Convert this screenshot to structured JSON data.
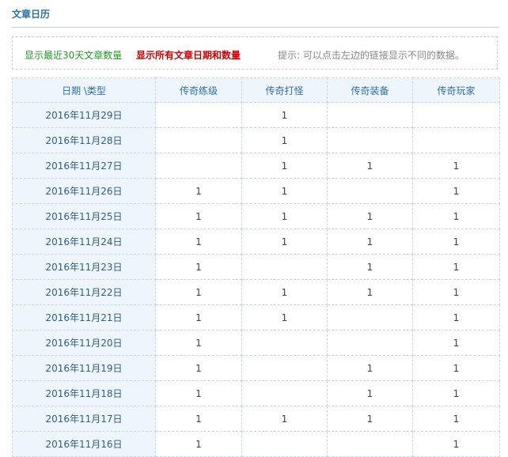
{
  "page": {
    "title": "文章日历"
  },
  "filter": {
    "recent_link": "显示最近30天文章数量",
    "all_link": "显示所有文章日期和数量",
    "hint": "提示: 可以点击左边的链接显示不同的数据。"
  },
  "table": {
    "headers": [
      "日期 \\类型",
      "传奇练级",
      "传奇打怪",
      "传奇装备",
      "传奇玩家"
    ],
    "rows": [
      {
        "date": "2016年11月29日",
        "counts": [
          "",
          "1",
          "",
          ""
        ]
      },
      {
        "date": "2016年11月28日",
        "counts": [
          "",
          "1",
          "",
          ""
        ]
      },
      {
        "date": "2016年11月27日",
        "counts": [
          "",
          "1",
          "1",
          "1"
        ]
      },
      {
        "date": "2016年11月26日",
        "counts": [
          "1",
          "1",
          "",
          "1"
        ]
      },
      {
        "date": "2016年11月25日",
        "counts": [
          "1",
          "1",
          "1",
          "1"
        ]
      },
      {
        "date": "2016年11月24日",
        "counts": [
          "1",
          "1",
          "1",
          "1"
        ]
      },
      {
        "date": "2016年11月23日",
        "counts": [
          "1",
          "",
          "1",
          "1"
        ]
      },
      {
        "date": "2016年11月22日",
        "counts": [
          "1",
          "1",
          "1",
          "1"
        ]
      },
      {
        "date": "2016年11月21日",
        "counts": [
          "1",
          "1",
          "",
          "1"
        ]
      },
      {
        "date": "2016年11月20日",
        "counts": [
          "1",
          "",
          "",
          "1"
        ]
      },
      {
        "date": "2016年11月19日",
        "counts": [
          "1",
          "",
          "1",
          "1"
        ]
      },
      {
        "date": "2016年11月18日",
        "counts": [
          "1",
          "",
          "1",
          "1"
        ]
      },
      {
        "date": "2016年11月17日",
        "counts": [
          "1",
          "1",
          "1",
          "1"
        ]
      },
      {
        "date": "2016年11月16日",
        "counts": [
          "1",
          "",
          "",
          "1"
        ]
      }
    ]
  }
}
